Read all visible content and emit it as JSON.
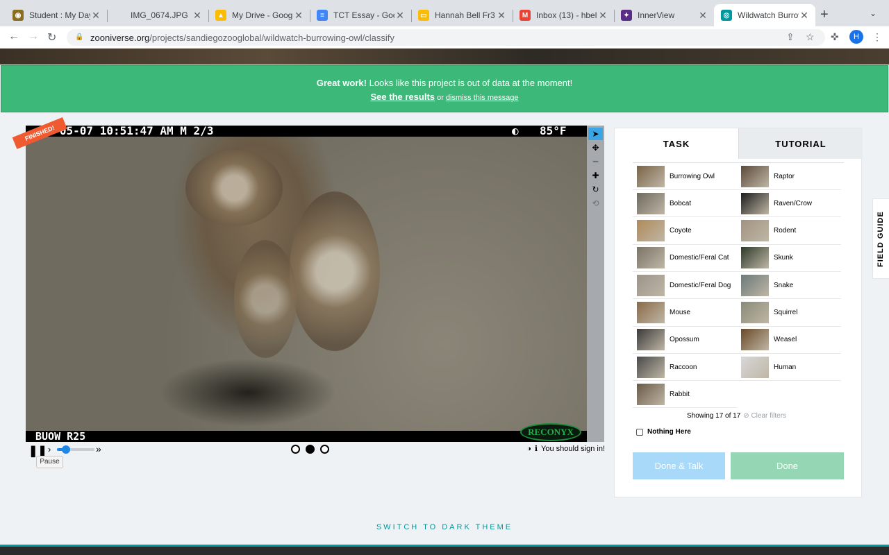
{
  "browser": {
    "tabs": [
      {
        "title": "Student : My Day",
        "color": "#8a6d1e",
        "glyph": "◉"
      },
      {
        "title": "IMG_0674.JPG",
        "color": "",
        "glyph": ""
      },
      {
        "title": "My Drive - Google",
        "color": "#fbbc04",
        "glyph": "▲"
      },
      {
        "title": "TCT Essay - Goog",
        "color": "#4285f4",
        "glyph": "≡"
      },
      {
        "title": "Hannah Bell Fr3 -",
        "color": "#fbbc04",
        "glyph": "▭"
      },
      {
        "title": "Inbox (13) - hbell",
        "color": "#ea4335",
        "glyph": "M"
      },
      {
        "title": "InnerView",
        "color": "#5b2c83",
        "glyph": "✦"
      },
      {
        "title": "Wildwatch Burrow",
        "color": "#00979d",
        "glyph": "◎"
      }
    ],
    "url_host": "zooniverse.org",
    "url_path": "/projects/sandiegozooglobal/wildwatch-burrowing-owl/classify",
    "avatar_letter": "H"
  },
  "banner": {
    "strong": "Great work!",
    "message": " Looks like this project is out of data at the moment!",
    "results_link": "See the results",
    "or": " or ",
    "dismiss_link": "dismiss this message"
  },
  "viewer": {
    "finished_label": "FINISHED!",
    "osd_top_left": "18-05-07 10:51:47 AM  M 2/3",
    "osd_top_right": "85°F",
    "osd_bottom": "BUOW R25",
    "reconyx": "RECONYX",
    "frame_count": 3,
    "current_frame": 2,
    "playback_speed_fraction": 0.2,
    "sign_in_text": "You should sign in!",
    "tooltip": "Pause"
  },
  "panel": {
    "tab_task": "TASK",
    "tab_tutorial": "TUTORIAL",
    "species": [
      {
        "name": "Burrowing Owl",
        "color": "#7a6448"
      },
      {
        "name": "Raptor",
        "color": "#5c4a3a"
      },
      {
        "name": "Bobcat",
        "color": "#6e6a60"
      },
      {
        "name": "Raven/Crow",
        "color": "#1c1c1c"
      },
      {
        "name": "Coyote",
        "color": "#b08a5a"
      },
      {
        "name": "Rodent",
        "color": "#a09480"
      },
      {
        "name": "Domestic/Feral Cat",
        "color": "#7a7468"
      },
      {
        "name": "Skunk",
        "color": "#2e3a2a"
      },
      {
        "name": "Domestic/Feral Dog",
        "color": "#9a948a"
      },
      {
        "name": "Snake",
        "color": "#6a7a7a"
      },
      {
        "name": "Mouse",
        "color": "#8a6a48"
      },
      {
        "name": "Squirrel",
        "color": "#8a8a78"
      },
      {
        "name": "Opossum",
        "color": "#3a3a3a"
      },
      {
        "name": "Weasel",
        "color": "#6a4a28"
      },
      {
        "name": "Raccoon",
        "color": "#4a4a4a"
      },
      {
        "name": "Human",
        "color": "#d8d8d8"
      },
      {
        "name": "Rabbit",
        "color": "#6a5a48"
      }
    ],
    "showing": "Showing 17 of 17",
    "clear_filters": "Clear filters",
    "nothing_here": "Nothing Here",
    "done_talk": "Done & Talk",
    "done": "Done",
    "field_guide": "FIELD GUIDE"
  },
  "page": {
    "dark_theme": "SWITCH TO DARK THEME"
  }
}
